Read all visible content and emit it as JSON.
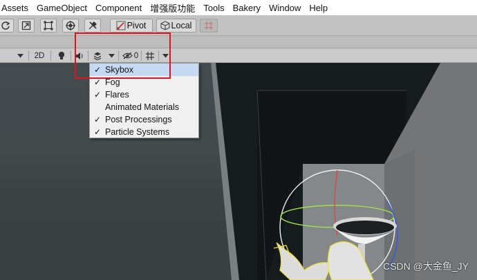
{
  "menu": [
    "Assets",
    "GameObject",
    "Component",
    "增强版功能",
    "Tools",
    "Bakery",
    "Window",
    "Help"
  ],
  "toolbar": {
    "pivot_label": "Pivot",
    "local_label": "Local",
    "icons": [
      "rotate-tool-icon",
      "scale-tool-icon",
      "rect-tool-icon",
      "transform-tool-icon",
      "custom-tool-icon",
      "grid-snap-icon"
    ]
  },
  "scene_toolbar": {
    "mode_2d": "2D",
    "hidden_count": "0",
    "icons": [
      "lighting-icon",
      "audio-icon",
      "effects-icon",
      "visibility-icon",
      "grid-icon"
    ]
  },
  "effects_dropdown": {
    "items": [
      {
        "label": "Skybox",
        "checked": true
      },
      {
        "label": "Fog",
        "checked": true
      },
      {
        "label": "Flares",
        "checked": true
      },
      {
        "label": "Animated Materials",
        "checked": false
      },
      {
        "label": "Post Processings",
        "checked": true
      },
      {
        "label": "Particle Systems",
        "checked": true
      }
    ],
    "check_glyph": "✓"
  },
  "watermark": "CSDN @大金鱼_JY",
  "colors": {
    "highlight": "#e0141c",
    "menu_bg": "#ffffff",
    "toolbar_bg": "#c2c2c2",
    "scene_bg": "#434b4e"
  }
}
